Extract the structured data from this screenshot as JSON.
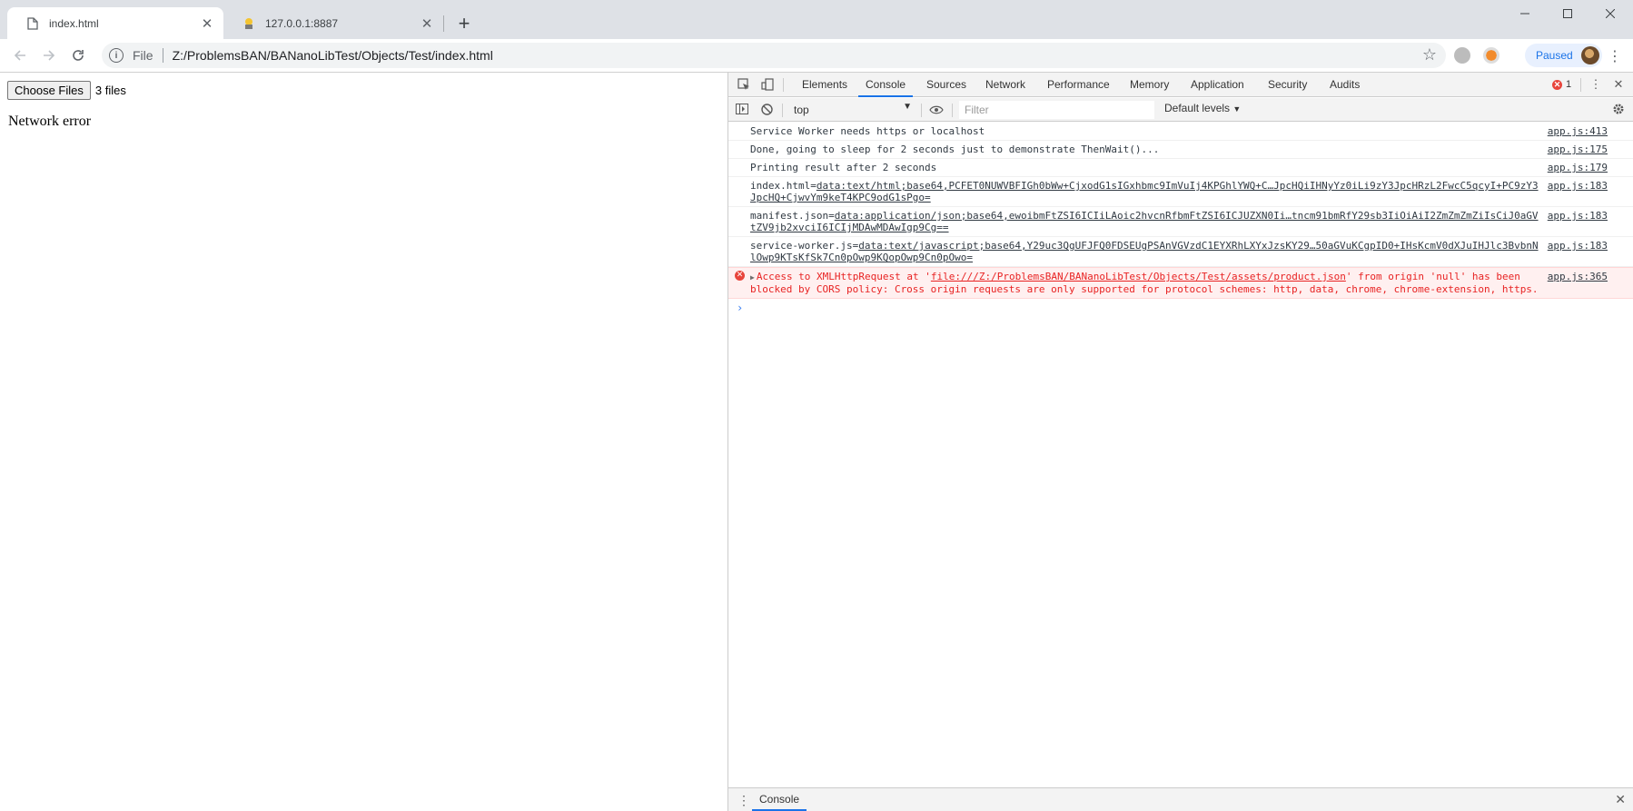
{
  "browser": {
    "tabs": [
      {
        "title": "index.html",
        "active": true
      },
      {
        "title": "127.0.0.1:8887",
        "active": false
      }
    ],
    "new_tab": "+",
    "window_buttons": {
      "minimize": "—",
      "maximize": "☐",
      "close": "✕"
    },
    "toolbar": {
      "scheme": "File",
      "url": "Z:/ProblemsBAN/BANanoLibTest/Objects/Test/index.html",
      "profile_label": "Paused"
    }
  },
  "page": {
    "choose_files_label": "Choose Files",
    "file_count": "3 files",
    "network_error": "Network error"
  },
  "devtools": {
    "tabs": [
      "Elements",
      "Console",
      "Sources",
      "Network",
      "Performance",
      "Memory",
      "Application",
      "Security",
      "Audits"
    ],
    "active_tab": "Console",
    "error_count": "1",
    "context": "top",
    "filter_placeholder": "Filter",
    "levels": "Default levels",
    "messages": [
      {
        "text": "Service Worker needs https or localhost",
        "source": "app.js:413"
      },
      {
        "text": "Done, going to sleep for 2 seconds just to demonstrate ThenWait()...",
        "source": "app.js:175"
      },
      {
        "text": "Printing result after 2 seconds",
        "source": "app.js:179"
      },
      {
        "prefix": "index.html=",
        "link": "data:text/html;base64,PCFET0NUWVBFIGh0bWw+CjxodG1sIGxhbmc9ImVuIj4KPGhlYWQ+C…JpcHQiIHNyYz0iLi9zY3JpcHRzL2FwcC5qcyI+PC9zY3JpcHQ+CjwvYm9keT4KPC9odG1sPgo=",
        "source": "app.js:183"
      },
      {
        "prefix": "manifest.json=",
        "link": "data:application/json;base64,ewoibmFtZSI6ICIiLAoic2hvcnRfbmFtZSI6ICJUZXN0Ii…tncm91bmRfY29sb3IiOiAiI2ZmZmZmZiIsCiJ0aGVtZV9jb2xvciI6ICIjMDAwMDAwIgp9Cg==",
        "source": "app.js:183"
      },
      {
        "prefix": "service-worker.js=",
        "link": "data:text/javascript;base64,Y29uc3QgUFJFQ0FDSEUgPSAnVGVzdC1EYXRhLXYxJzsKY29…50aGVuKCgpID0+IHsKcmV0dXJuIHJlc3BvbnNlOwp9KTsKfSk7Cn0pOwp9KQopOwp9Cn0pOwo=",
        "source": "app.js:183"
      }
    ],
    "error_message": {
      "before": "Access to XMLHttpRequest at '",
      "link": "file:///Z:/ProblemsBAN/BANanoLibTest/Objects/Test/assets/product.json",
      "after": "' from origin 'null' has been blocked by CORS policy: Cross origin requests are only supported for protocol schemes: http, data, chrome, chrome-extension, https.",
      "source": "app.js:365"
    },
    "drawer_tab": "Console"
  },
  "colors": {
    "accent": "#1a73e8",
    "error": "#e82323",
    "error_bg": "#fff0f0",
    "tabstrip": "#dee1e6"
  }
}
